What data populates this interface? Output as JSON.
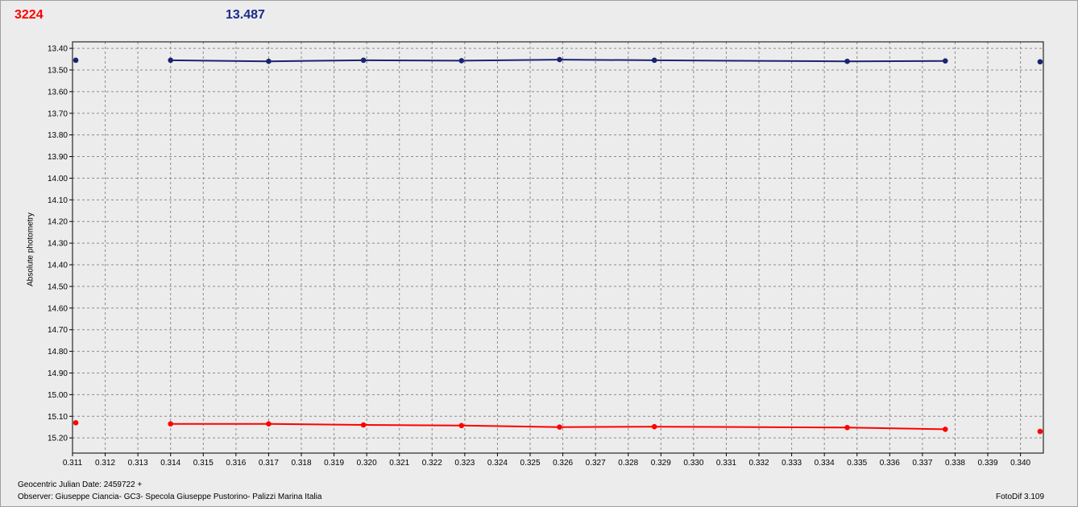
{
  "header": {
    "object_id": "3224",
    "magnitude": "13.487"
  },
  "footer": {
    "date_label": "Geocentric Julian Date: 2459722 +",
    "observer": "Observer: Giuseppe Ciancia- GC3- Specola Giuseppe Pustorino- Palizzi Marina Italia",
    "version": "FotoDif 3.109"
  },
  "colors": {
    "series_blue": "#1a2370",
    "series_red": "#ff0000",
    "grid": "#8c8c8c",
    "plot_bg": "#ececec",
    "header_red": "#ff0000",
    "header_blue": "#1a2a8a"
  },
  "chart_data": {
    "type": "line",
    "title": "",
    "xlabel": "",
    "ylabel": "Absolute photometry",
    "xlim": [
      0.311,
      0.3407
    ],
    "ylim": [
      13.37,
      15.27
    ],
    "y_inverted": true,
    "grid": true,
    "x_ticks": [
      "0.311",
      "0.312",
      "0.313",
      "0.314",
      "0.315",
      "0.316",
      "0.317",
      "0.318",
      "0.319",
      "0.320",
      "0.321",
      "0.322",
      "0.323",
      "0.324",
      "0.325",
      "0.326",
      "0.327",
      "0.328",
      "0.329",
      "0.330",
      "0.331",
      "0.332",
      "0.333",
      "0.334",
      "0.335",
      "0.336",
      "0.337",
      "0.338",
      "0.339",
      "0.340"
    ],
    "y_ticks": [
      "13.40",
      "13.50",
      "13.60",
      "13.70",
      "13.80",
      "13.90",
      "14.00",
      "14.10",
      "14.20",
      "14.30",
      "14.40",
      "14.50",
      "14.60",
      "14.70",
      "14.80",
      "14.90",
      "15.00",
      "15.10",
      "15.20"
    ],
    "series": [
      {
        "color": "#1a2370",
        "x": [
          0.3111,
          0.314,
          0.317,
          0.3199,
          0.3229,
          0.3259,
          0.3288,
          0.3347,
          0.3377,
          0.3406
        ],
        "y": [
          13.455,
          13.455,
          13.46,
          13.455,
          13.457,
          13.452,
          13.455,
          13.46,
          13.458,
          13.462
        ],
        "line_from_index": 1,
        "line_to_index": 8
      },
      {
        "color": "#ff0000",
        "x": [
          0.3111,
          0.314,
          0.317,
          0.3199,
          0.3229,
          0.3259,
          0.3288,
          0.3347,
          0.3377,
          0.3406
        ],
        "y": [
          15.13,
          15.135,
          15.135,
          15.14,
          15.143,
          15.15,
          15.148,
          15.152,
          15.16,
          15.17
        ],
        "line_from_index": 1,
        "line_to_index": 8
      }
    ]
  }
}
